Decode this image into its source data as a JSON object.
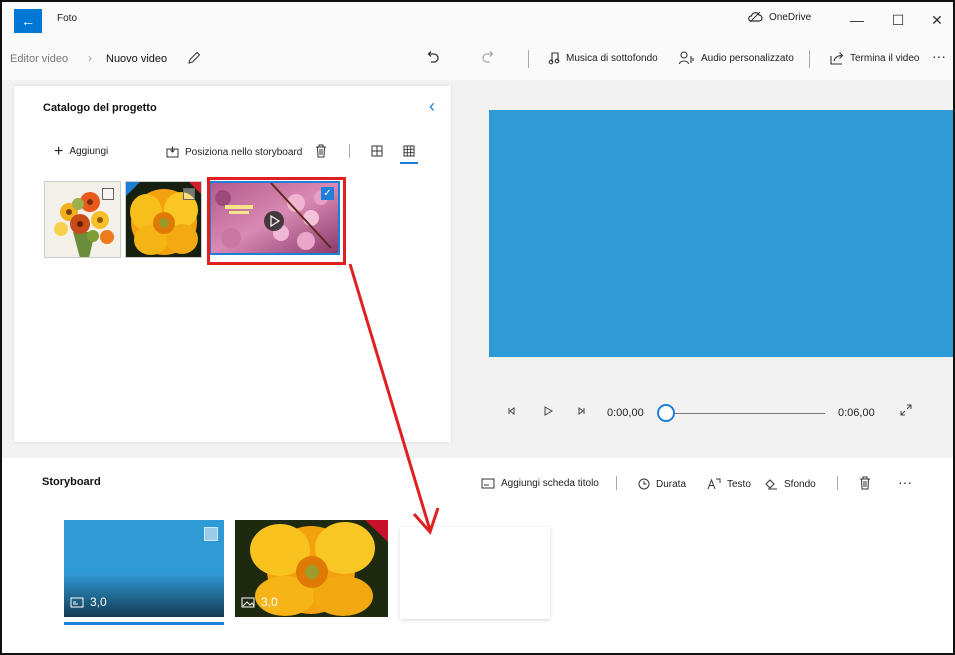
{
  "titlebar": {
    "app_name": "Foto",
    "cloud_label": "OneDrive",
    "minimize_glyph": "—",
    "maximize_glyph": "☐",
    "close_glyph": "✕"
  },
  "toolbar": {
    "breadcrumb_root": "Editor video",
    "breadcrumb_current": "Nuovo video",
    "background_music": "Musica di sottofondo",
    "custom_audio": "Audio personalizzato",
    "finish_video": "Termina il video",
    "more": "···"
  },
  "catalog": {
    "title": "Catalogo del progetto",
    "add_label": "Aggiungi",
    "place_in_storyboard": "Posiziona nello storyboard",
    "items": [
      {
        "name": "flower-bouquet",
        "selected": false
      },
      {
        "name": "yellow-flower",
        "selected": false
      },
      {
        "name": "pink-blossom-video",
        "selected": true
      }
    ]
  },
  "preview": {
    "current_time": "0:00,00",
    "total_time": "0:06,00",
    "progress": 0
  },
  "storyboard": {
    "title": "Storyboard",
    "add_title_card": "Aggiungi scheda titolo",
    "duration": "Durata",
    "text": "Testo",
    "background": "Sfondo",
    "more": "···",
    "cards": [
      {
        "type": "title-card",
        "duration": "3,0"
      },
      {
        "type": "image",
        "duration": "3,0"
      }
    ]
  },
  "colors": {
    "accent": "#0078d7",
    "preview_fill": "#2f9bd6",
    "annotation": "#e02020"
  }
}
